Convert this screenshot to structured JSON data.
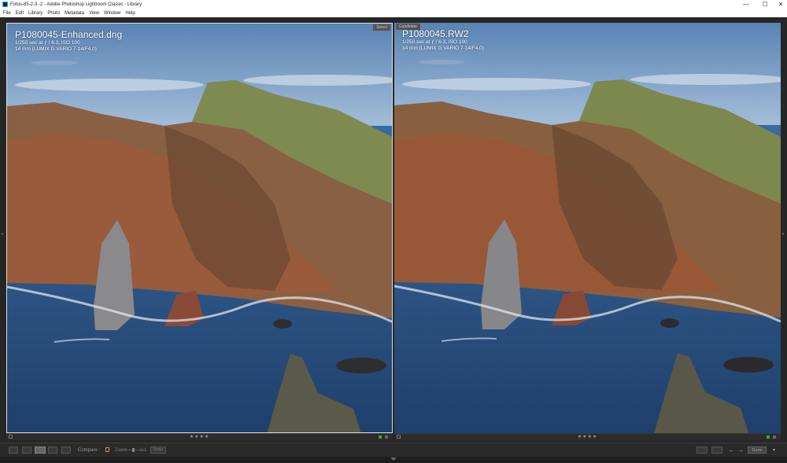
{
  "window": {
    "title": "Fotos-85-2-3 -2 - Adobe Photoshop Lightroom Classic - Library",
    "controls": {
      "minimize": "—",
      "maximize": "☐",
      "close": "✕"
    }
  },
  "menu": [
    "File",
    "Edit",
    "Library",
    "Photo",
    "Metadata",
    "View",
    "Window",
    "Help"
  ],
  "select_pane": {
    "badge": "Select",
    "filename": "P1080045-Enhanced.dng",
    "exposure": "1/250 sec at ƒ / 6.3, ISO 100",
    "lens": "14 mm (LUMIX G VARIO 7-14/F4.0)"
  },
  "candidate_pane": {
    "badge": "Candidate",
    "filename": "P1080045.RW2",
    "exposure": "1/250 sec at ƒ / 6.3, ISO 100",
    "lens": "14 mm (LUMIX G VARIO 7-14/F4.0)"
  },
  "rating": {
    "select_stars": "★★★★",
    "candidate_stars": "★★★★"
  },
  "toolbar": {
    "compare_label": "Compare :",
    "zoom_label": "Zoom",
    "zoom_ratio": "1:1",
    "swap_label": "Swap",
    "done_label": "Done",
    "prev_arrow": "←",
    "next_arrow": "→",
    "chevron": "▾"
  },
  "colors": {
    "accent_green": "#3fa63f",
    "lock_gold": "#c9a440",
    "ocean": "#2f5a8e",
    "sky": "#6f95c2"
  },
  "icons": [
    "grid-view-icon",
    "loupe-view-icon",
    "compare-view-icon",
    "survey-view-icon",
    "people-view-icon",
    "lock-icon"
  ]
}
